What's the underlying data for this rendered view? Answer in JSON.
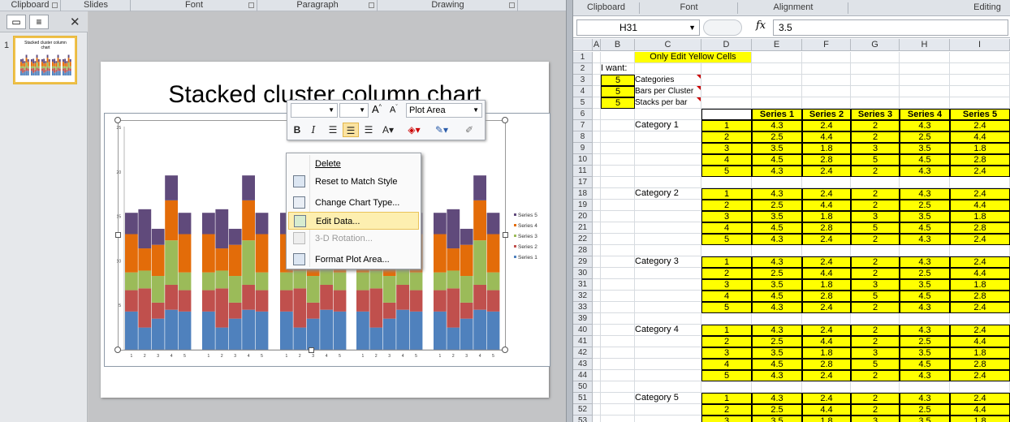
{
  "ppt": {
    "ribbon_groups": [
      "Clipboard",
      "Slides",
      "Font",
      "Paragraph",
      "Drawing"
    ],
    "slide_number": "1",
    "thumb_title": "Stacked cluster column chart",
    "slide_title": "Stacked cluster column chart",
    "minitoolbar": {
      "font_value": "",
      "size_value": "",
      "element_dropdown": "Plot Area",
      "bold": "B",
      "italic": "I"
    },
    "context_menu": [
      {
        "label": "Delete",
        "enabled": true,
        "highlight": false
      },
      {
        "label": "Reset to Match Style",
        "enabled": true,
        "highlight": false
      },
      {
        "label": "Change Chart Type...",
        "enabled": true,
        "highlight": false
      },
      {
        "label": "Edit Data...",
        "enabled": true,
        "highlight": true
      },
      {
        "label": "3-D Rotation...",
        "enabled": false,
        "highlight": false
      },
      {
        "label": "Format Plot Area...",
        "enabled": true,
        "highlight": false
      }
    ]
  },
  "chart_data": {
    "type": "bar",
    "stacked": true,
    "clusters": 5,
    "bars_per_cluster": 5,
    "categories": [
      "1",
      "2",
      "3",
      "4",
      "5"
    ],
    "ylim": [
      0,
      25
    ],
    "yticks": [
      "0",
      "5",
      "10",
      "15",
      "20",
      "25"
    ],
    "legend_position": "right",
    "legend": [
      "Series 5",
      "Series 4",
      "Series 3",
      "Series 2",
      "Series 1"
    ],
    "series": [
      {
        "name": "Series 1",
        "color": "#4f81bd",
        "values": [
          4.3,
          2.5,
          3.5,
          4.5,
          4.3
        ]
      },
      {
        "name": "Series 2",
        "color": "#c0504d",
        "values": [
          2.4,
          4.4,
          1.8,
          2.8,
          2.4
        ]
      },
      {
        "name": "Series 3",
        "color": "#9bbb59",
        "values": [
          2,
          2,
          3,
          5,
          2
        ]
      },
      {
        "name": "Series 4",
        "color": "#e36c09",
        "values": [
          4.3,
          2.5,
          3.5,
          4.5,
          4.3
        ]
      },
      {
        "name": "Series 5",
        "color": "#604a7b",
        "values": [
          2.4,
          4.4,
          1.8,
          2.8,
          2.4
        ]
      }
    ]
  },
  "excel": {
    "ribbon_groups": [
      "Clipboard",
      "Font",
      "Alignment",
      "Editing"
    ],
    "name_box": "H31",
    "fx": "fx",
    "formula_value": "3.5",
    "columns": [
      "A",
      "B",
      "C",
      "D",
      "E",
      "F",
      "G",
      "H",
      "I"
    ],
    "yellow_note": "Only Edit Yellow Cells",
    "i_want": "I want:",
    "inputs": [
      {
        "value": "5",
        "label": "Categories"
      },
      {
        "value": "5",
        "label": "Bars per Cluster"
      },
      {
        "value": "5",
        "label": "Stacks per bar"
      }
    ],
    "series_headers": [
      "Series 1",
      "Series 2",
      "Series 3",
      "Series 4",
      "Series 5"
    ],
    "row_values": [
      [
        "1",
        "4.3",
        "2.4",
        "2",
        "4.3",
        "2.4"
      ],
      [
        "2",
        "2.5",
        "4.4",
        "2",
        "2.5",
        "4.4"
      ],
      [
        "3",
        "3.5",
        "1.8",
        "3",
        "3.5",
        "1.8"
      ],
      [
        "4",
        "4.5",
        "2.8",
        "5",
        "4.5",
        "2.8"
      ],
      [
        "5",
        "4.3",
        "2.4",
        "2",
        "4.3",
        "2.4"
      ]
    ],
    "blocks": [
      {
        "category": "Category 1",
        "rows": [
          "7",
          "8",
          "9",
          "10",
          "11"
        ],
        "blank_after": "17"
      },
      {
        "category": "Category 2",
        "rows": [
          "18",
          "19",
          "20",
          "21",
          "22"
        ],
        "blank_after": "28"
      },
      {
        "category": "Category 3",
        "rows": [
          "29",
          "30",
          "31",
          "32",
          "33"
        ],
        "blank_after": "39"
      },
      {
        "category": "Category 4",
        "rows": [
          "40",
          "41",
          "42",
          "43",
          "44"
        ],
        "blank_after": "50"
      },
      {
        "category": "Category 5",
        "rows": [
          "51",
          "52",
          "53"
        ],
        "blank_after": ""
      }
    ],
    "top_rows": [
      "1",
      "2",
      "3",
      "4",
      "5",
      "6"
    ]
  }
}
